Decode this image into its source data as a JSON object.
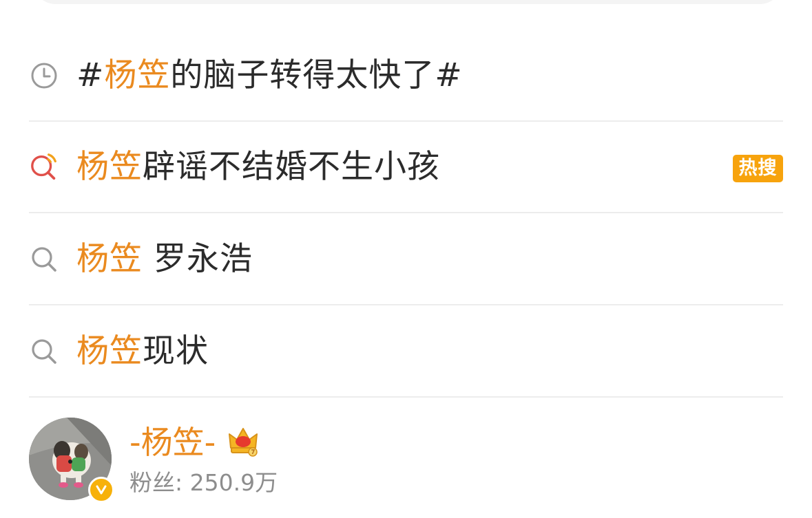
{
  "search_bar": {},
  "suggestions": [
    {
      "icon": "history-clock-icon",
      "prefix": "#",
      "highlight": "杨笠",
      "rest": "的脑子转得太快了#",
      "badge": ""
    },
    {
      "icon": "hot-search-icon",
      "prefix": "",
      "highlight": "杨笠",
      "rest": "辟谣不结婚不生小孩",
      "badge": "热搜"
    },
    {
      "icon": "search-icon",
      "prefix": "",
      "highlight": "杨笠",
      "rest": " 罗永浩",
      "badge": ""
    },
    {
      "icon": "search-icon",
      "prefix": "",
      "highlight": "杨笠",
      "rest": "现状",
      "badge": ""
    }
  ],
  "user": {
    "name": "-杨笠-",
    "fans": "粉丝: 250.9万",
    "verified_icon": "verified-v-icon",
    "vip_icon": "crown-vip-icon"
  },
  "colors": {
    "highlight": "#ea8a1f",
    "badge": "#f7a30d",
    "text": "#2b2b2b",
    "secondary": "#8d8d8d",
    "divider": "#ececec"
  }
}
